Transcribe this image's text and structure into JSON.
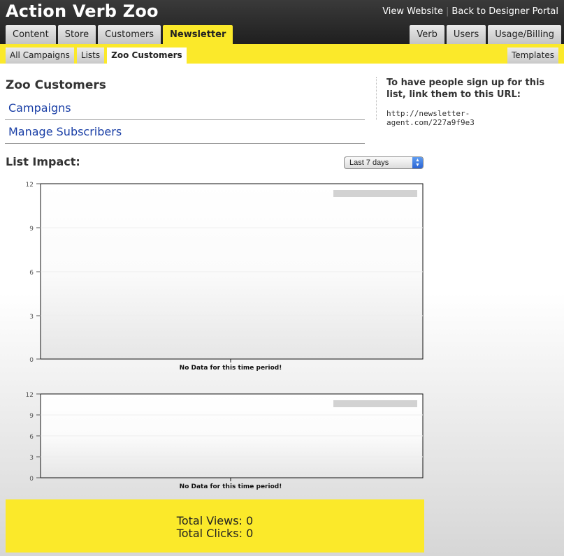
{
  "header": {
    "title": "Action Verb Zoo",
    "links": [
      "View Website",
      "Back to Designer Portal"
    ],
    "separator": "|",
    "tabs_left": [
      "Content",
      "Store",
      "Customers",
      "Newsletter"
    ],
    "tabs_right": [
      "Verb",
      "Users",
      "Usage/Billing"
    ],
    "active_tab": "Newsletter"
  },
  "subnav": {
    "tabs": [
      "All Campaigns",
      "Lists",
      "Zoo Customers"
    ],
    "active": "Zoo Customers",
    "templates_label": "Templates"
  },
  "main": {
    "title": "Zoo Customers",
    "links": [
      "Campaigns",
      "Manage Subscribers"
    ],
    "impact_title": "List Impact:",
    "range_selected": "Last 7 days"
  },
  "signup": {
    "text": "To have people sign up for this list, link them to this URL:",
    "url": "http://newsletter-agent.com/227a9f9e3"
  },
  "charts": [
    {
      "yticks": [
        "12",
        "9",
        "6",
        "3",
        "0"
      ],
      "message": "No Data for this time period!"
    },
    {
      "yticks": [
        "12",
        "9",
        "6",
        "3",
        "0"
      ],
      "message": "No Data for this time period!"
    }
  ],
  "totals": {
    "views": "Total Views: 0",
    "clicks": "Total Clicks: 0"
  },
  "colors": {
    "accent": "#fbe92a",
    "header": "#2a2a2a",
    "link": "#1a3fa6"
  }
}
